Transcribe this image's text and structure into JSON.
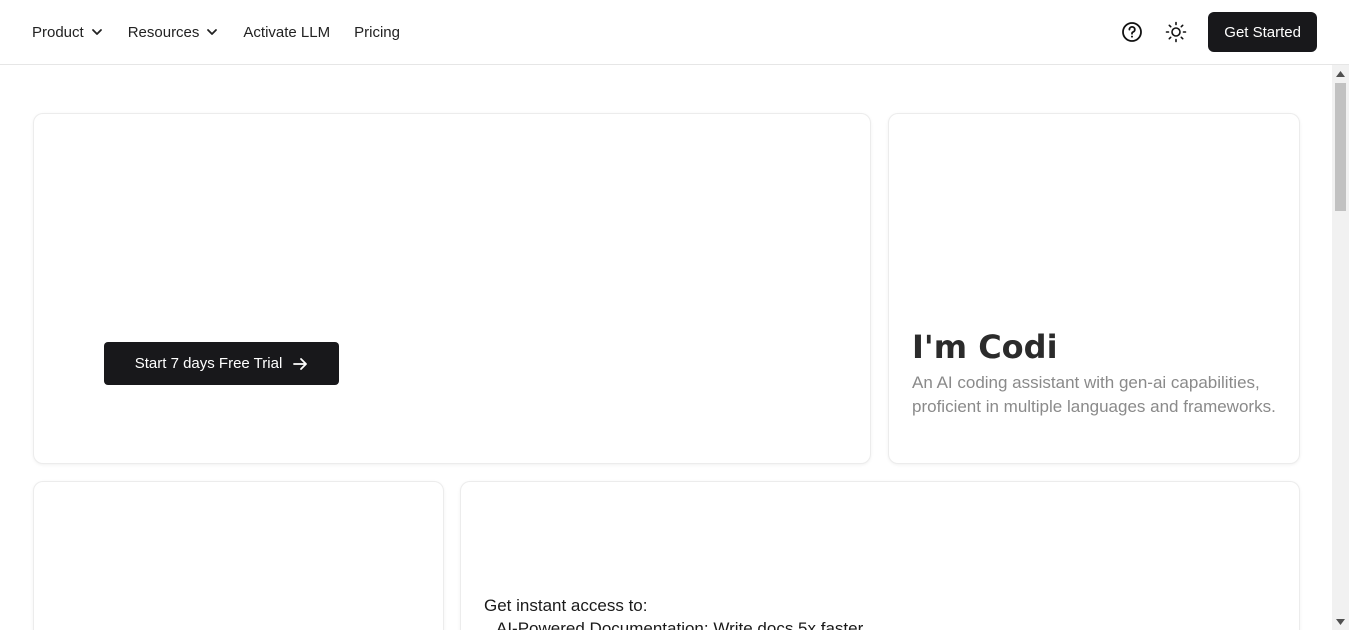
{
  "nav": {
    "items": [
      {
        "label": "Product",
        "has_dropdown": true
      },
      {
        "label": "Resources",
        "has_dropdown": true
      },
      {
        "label": "Activate LLM",
        "has_dropdown": false
      },
      {
        "label": "Pricing",
        "has_dropdown": false
      }
    ],
    "help_icon": "help-circle-icon",
    "theme_icon": "sun-icon",
    "cta_label": "Get Started"
  },
  "hero": {
    "trial_label": "Start 7 days Free Trial",
    "trial_icon": "arrow-right-icon"
  },
  "codi": {
    "title": "I'm Codi",
    "description": "An AI coding assistant with gen-ai capabilities, proficient in multiple languages and frameworks."
  },
  "access": {
    "heading": "Get instant access to:",
    "items": [
      "AI-Powered Documentation: Write docs 5x faster"
    ]
  },
  "colors": {
    "accent": "#18181b",
    "muted_text": "#8a8a8a",
    "border": "#ececec"
  }
}
